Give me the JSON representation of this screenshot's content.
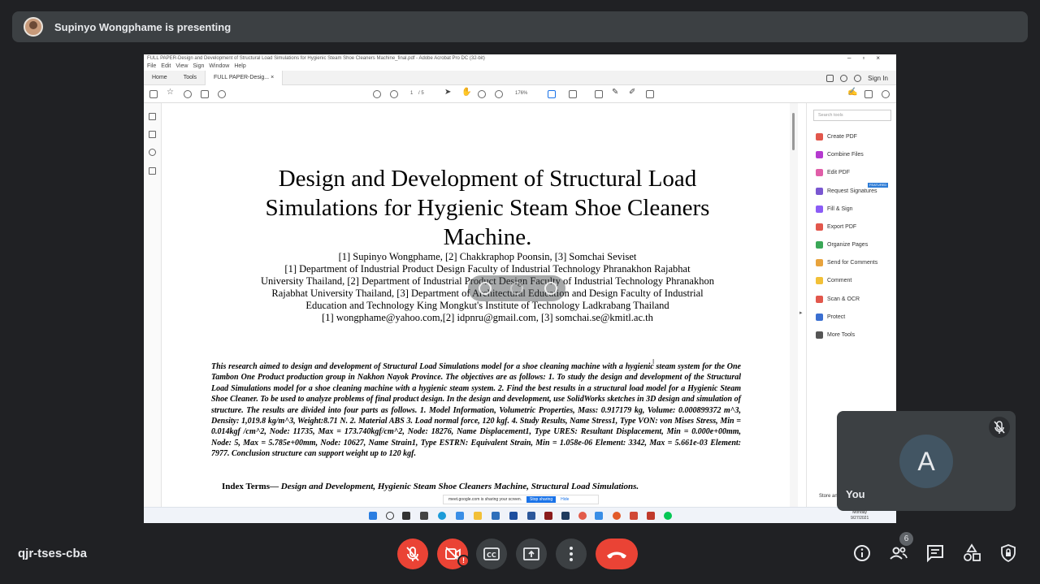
{
  "meeting": {
    "banner": "Supinyo Wongphame is presenting",
    "code": "qjr-tses-cba",
    "self_label": "You",
    "self_initial": "A",
    "participant_count": "6",
    "warning_badge": "!"
  },
  "acrobat": {
    "window_title": "FULL PAPER-Design and Development of Structural Load Simulations for Hygienic Steam Shoe Cleaners Machine_final.pdf - Adobe Acrobat Pro DC (32-bit)",
    "menu": [
      "File",
      "Edit",
      "View",
      "Sign",
      "Window",
      "Help"
    ],
    "tabs": {
      "home": "Home",
      "tools": "Tools",
      "doc": "FULL PAPER-Desig...",
      "close": "×"
    },
    "sign_in": "Sign In",
    "page_current": "1",
    "page_total": "/ 5",
    "zoom": "176%",
    "search_tools_placeholder": "Search tools",
    "tools": [
      {
        "label": "Create PDF",
        "color": "#e2574c"
      },
      {
        "label": "Combine Files",
        "color": "#b53acf"
      },
      {
        "label": "Edit PDF",
        "color": "#e05ea8"
      },
      {
        "label": "Request Signatures",
        "color": "#7a57d1"
      },
      {
        "label": "Fill & Sign",
        "color": "#8b5cf6"
      },
      {
        "label": "Export PDF",
        "color": "#e2574c"
      },
      {
        "label": "Organize Pages",
        "color": "#3aa757"
      },
      {
        "label": "Send for Comments",
        "color": "#e8a33d"
      },
      {
        "label": "Comment",
        "color": "#f2c037"
      },
      {
        "label": "Scan & OCR",
        "color": "#e2574c"
      },
      {
        "label": "Protect",
        "color": "#3b6fd1"
      },
      {
        "label": "More Tools",
        "color": "#555555"
      }
    ],
    "featured_badge": "FEATURED",
    "store_apps": "Store and",
    "sharing_bar": {
      "message": "meet.google.com is sharing your screen.",
      "stop": "Stop sharing",
      "hide": "Hide"
    },
    "clock": {
      "day": "Monday",
      "date": "9/27/2021"
    }
  },
  "paper": {
    "title_lines": [
      "Design and Development of Structural Load",
      "Simulations for Hygienic Steam Shoe Cleaners",
      "Machine."
    ],
    "author_lines": [
      "[1] Supinyo Wongphame, [2] Chakkraphop Poonsin, [3] Somchai Seviset",
      "[1] Department of Industrial Product Design Faculty of Industrial Technology Phranakhon Rajabhat",
      "University Thailand, [2] Department of Industrial Product Design Faculty of Industrial Technology Phranakhon",
      "Rajabhat University Thailand, [3] Department of Architectural Education and Design Faculty of Industrial",
      "Education and Technology King Mongkut's Institute of Technology Ladkrabang Thailand",
      "[1] wongphame@yahoo.com,[2] idpnru@gmail.com, [3] somchai.se@kmitl.ac.th"
    ],
    "abstract": "This research aimed to design and development of Structural Load Simulations model for a shoe cleaning machine with a hygienic steam system for the One Tambon One Product production group in Nakhon Nayok Province. The objectives are as follows: 1. To study the design and development of the Structural Load Simulations model for a shoe cleaning machine with a hygienic steam system. 2. Find the best results in a structural load model for a Hygienic Steam Shoe Cleaner. To be used to analyze problems of final product design. In the design and development, use SolidWorks sketches in 3D design and simulation of structure. The results are divided into four parts as follows. 1. Model Information, Volumetric Properties, Mass: 0.917179 kg, Volume: 0.000899372 m^3, Density: 1,019.8 kg/m^3, Weight:8.71 N. 2. Material ABS 3. Load normal force, 120 kgf. 4. Study Results, Name Stress1, Type VON: von Mises Stress, Min = 0.014kgf /cm^2, Node: 11735, Max = 173.740kgf/cm^2, Node: 18276, Name Displacement1, Type URES: Resultant Displacement, Min = 0.000e+00mm, Node: 5, Max = 5.785e+00mm, Node: 10627, Name Strain1, Type ESTRN: Equivalent Strain, Min = 1.058e-06 Element: 3342, Max = 5.661e-03 Element: 7977. Conclusion structure can support weight up to 120 kgf.",
    "index_label": "Index Terms—",
    "index_terms": "Design and Development, Hygienic Steam Shoe Cleaners Machine, Structural Load Simulations."
  }
}
